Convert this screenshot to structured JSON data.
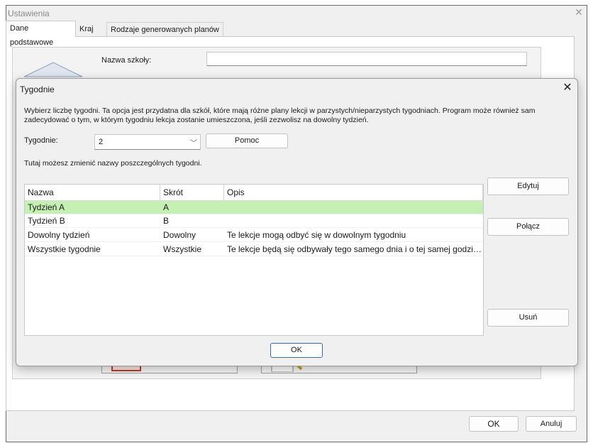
{
  "outer_window": {
    "title": "Ustawienia",
    "tabs": [
      {
        "label": "Dane podstawowe"
      },
      {
        "label": "Kraj"
      },
      {
        "label": "Rodzaje generowanych planów"
      }
    ],
    "school_name_label": "Nazwa szkoły:",
    "school_name_value": "",
    "ok_label": "OK",
    "cancel_label": "Anuluj"
  },
  "dialog": {
    "title": "Tygodnie",
    "description": "Wybierz liczbę tygodni. Ta opcja jest przydatna dla szkół, które mają różne plany lekcji w parzystych/nieparzystych tygodniach. Program może również sam zadecydować o tym, w którym tygodniu lekcja zostanie umieszczona, jeśli zezwolisz na dowolny tydzień.",
    "weeks_label": "Tygodnie:",
    "weeks_value": "2",
    "help_label": "Pomoc",
    "rename_hint": "Tutaj możesz zmienić nazwy poszczególnych tygodni.",
    "columns": [
      "Nazwa",
      "Skrót",
      "Opis"
    ],
    "rows": [
      {
        "name": "Tydzień A",
        "short": "A",
        "desc": "",
        "selected": true
      },
      {
        "name": "Tydzień B",
        "short": "B",
        "desc": "",
        "selected": false
      },
      {
        "name": "Dowolny tydzień",
        "short": "Dowolny",
        "desc": "Te lekcje mogą odbyć się w dowolnym tygodniu",
        "selected": false
      },
      {
        "name": "Wszystkie tygodnie",
        "short": "Wszystkie",
        "desc": "Te lekcje będą się odbywały tego samego dnia i o tej samej godzin...",
        "selected": false
      }
    ],
    "edit_label": "Edytuj",
    "merge_label": "Połącz",
    "delete_label": "Usuń",
    "ok_label": "OK"
  },
  "colors": {
    "selected_row": "#c4f0b4",
    "ok_border": "#2f6fae"
  }
}
